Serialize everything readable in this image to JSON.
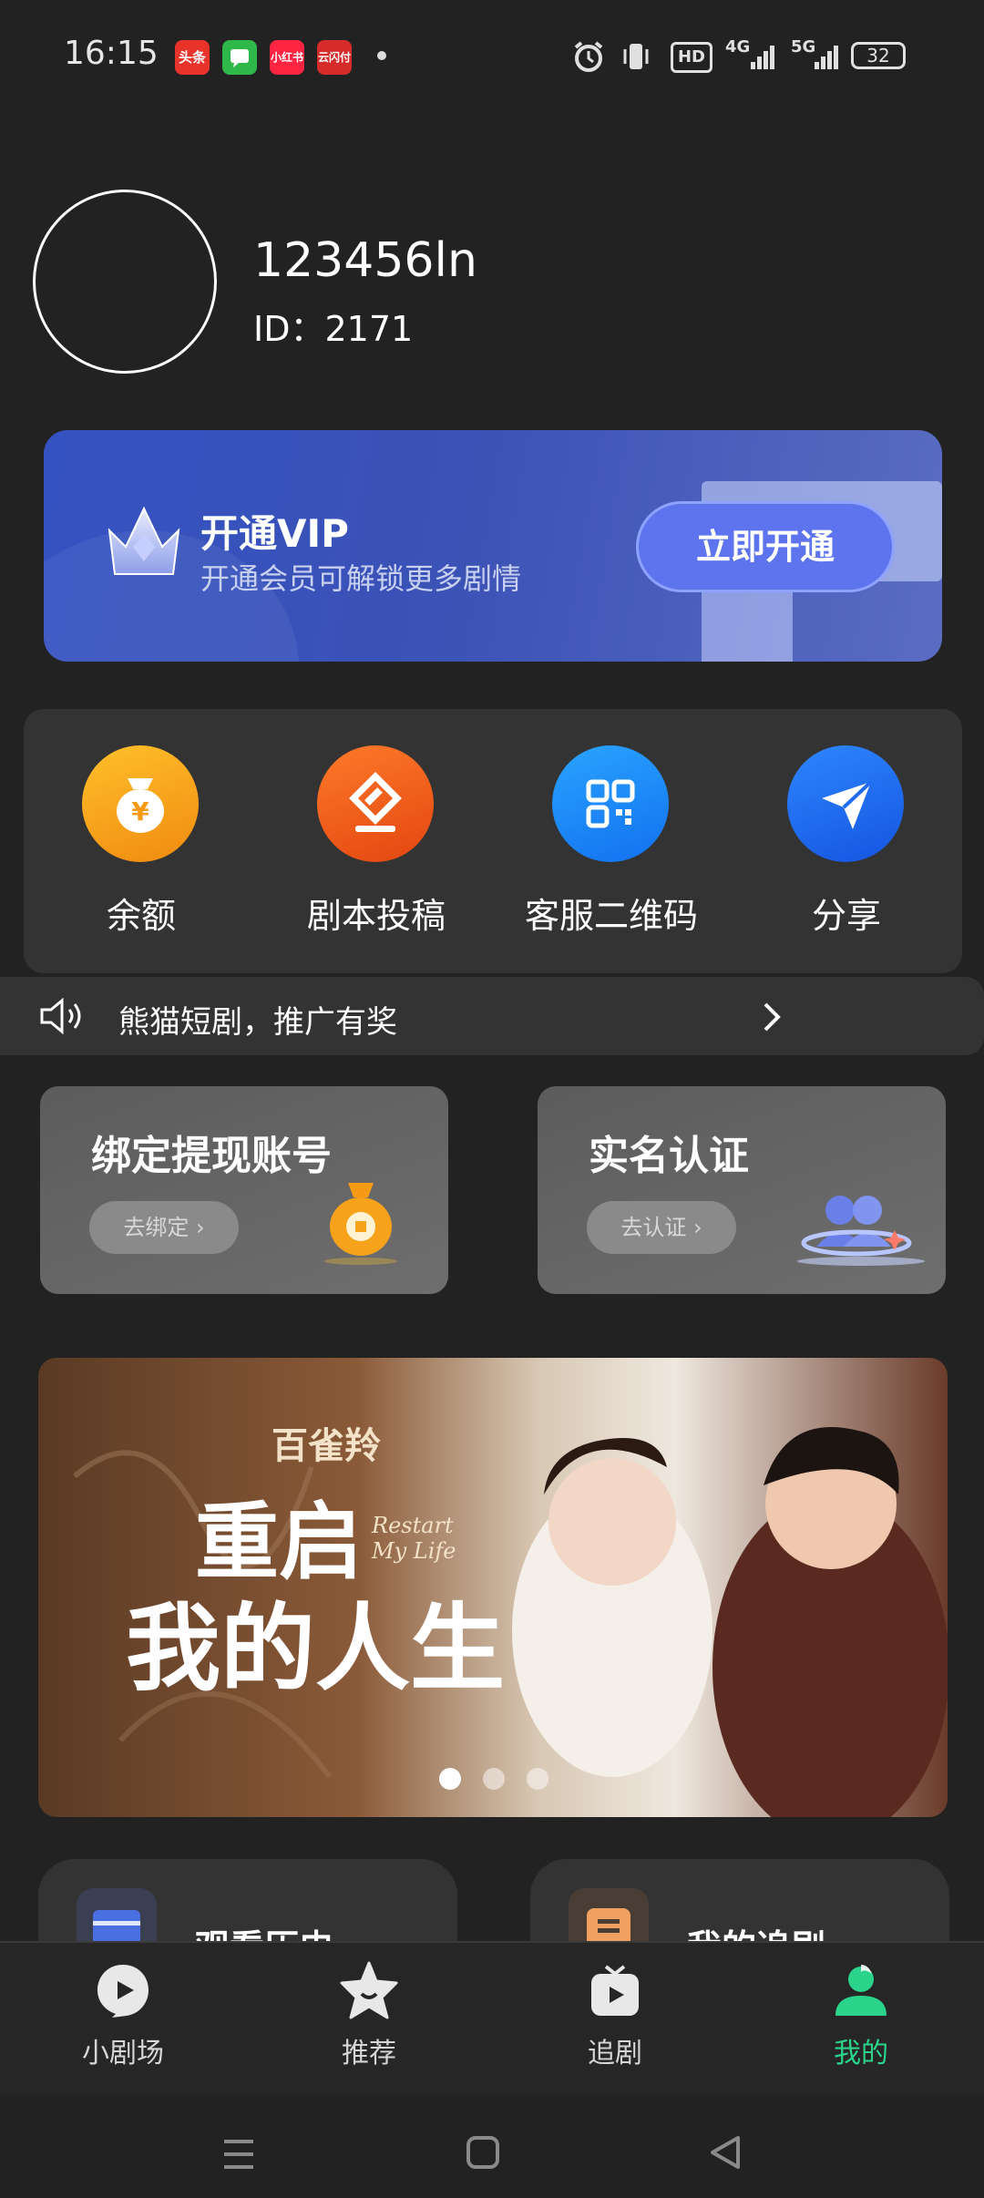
{
  "status_bar": {
    "time": "16:15",
    "apps": [
      {
        "label": "头条",
        "color": "#e8332a"
      },
      {
        "label": "消息",
        "color": "#2fb84a"
      },
      {
        "label": "小红书",
        "color": "#ff2442"
      },
      {
        "label": "云闪付",
        "color": "#d62b2b"
      }
    ],
    "hd_label": "HD",
    "net1": "4G",
    "net2": "5G",
    "battery": "32"
  },
  "profile": {
    "username": "123456ln",
    "id_label": "ID：2171"
  },
  "vip": {
    "title": "开通VIP",
    "subtitle": "开通会员可解锁更多剧情",
    "button": "立即开通"
  },
  "grid": [
    {
      "label": "余额",
      "icon": "money-bag-icon",
      "color": "#f7a21b"
    },
    {
      "label": "剧本投稿",
      "icon": "script-submit-icon",
      "color": "#f2591a"
    },
    {
      "label": "客服二维码",
      "icon": "qr-code-icon",
      "color": "#1a8cff"
    },
    {
      "label": "分享",
      "icon": "share-icon",
      "color": "#1f6cf2"
    }
  ],
  "notice": {
    "text": "熊猫短剧，推广有奖"
  },
  "cards": [
    {
      "title": "绑定提现账号",
      "button": "去绑定"
    },
    {
      "title": "实名认证",
      "button": "去认证"
    }
  ],
  "banner": {
    "brand": "百雀羚",
    "title_line1": "重启",
    "title_line2": "我的人生",
    "english": "Restart My Life"
  },
  "shortcuts": [
    {
      "label": "观看历史",
      "icon": "history-icon",
      "color": "#4a6fe0"
    },
    {
      "label": "我的追剧",
      "icon": "following-icon",
      "color": "#f0a060"
    }
  ],
  "tabs": [
    {
      "label": "小剧场",
      "icon": "theater-icon",
      "active": false
    },
    {
      "label": "推荐",
      "icon": "star-icon",
      "active": false
    },
    {
      "label": "追剧",
      "icon": "tv-icon",
      "active": false
    },
    {
      "label": "我的",
      "icon": "profile-icon",
      "active": true
    }
  ],
  "colors": {
    "active_tab": "#2bd48a",
    "background": "#222222"
  }
}
